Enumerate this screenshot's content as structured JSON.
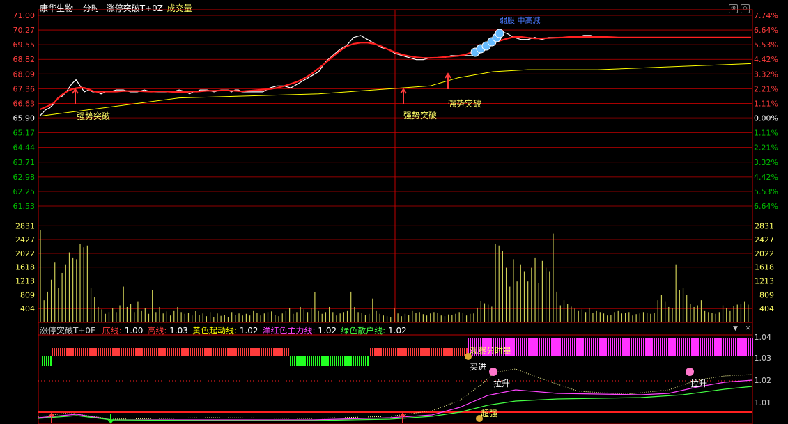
{
  "header": {
    "stock_name": "康华生物",
    "mode": "分时",
    "indicator": "涨停突破T+0Z",
    "volume_label": "成交量"
  },
  "price_axis": {
    "left": [
      "71.00",
      "70.27",
      "69.55",
      "68.82",
      "68.09",
      "67.36",
      "66.63",
      "65.90",
      "65.17",
      "64.44",
      "63.71",
      "62.98",
      "62.25",
      "61.53"
    ],
    "right": [
      "7.74%",
      "6.64%",
      "5.53%",
      "4.42%",
      "3.32%",
      "2.21%",
      "1.11%",
      "0.00%",
      "1.11%",
      "2.21%",
      "3.32%",
      "4.42%",
      "5.53%",
      "6.64%"
    ],
    "base_index": 7
  },
  "volume_axis": {
    "labels": [
      "2831",
      "2427",
      "2022",
      "1618",
      "1213",
      "809",
      "404"
    ]
  },
  "annotations": {
    "breakout1": "强势突破",
    "breakout2": "强势突破",
    "breakout3": "强势突破",
    "weak": "弱股 中高减"
  },
  "sub_panel": {
    "name": "涨停突破T+0F",
    "legend": [
      {
        "label": "底线:",
        "value": "1.00",
        "color": "#ff3c3c"
      },
      {
        "label": "高线:",
        "value": "1.03",
        "color": "#ff3c3c"
      },
      {
        "label": "黄色起动线:",
        "value": "1.02",
        "color": "#ffff00"
      },
      {
        "label": "洋红色主力线:",
        "value": "1.02",
        "color": "#ff44ff"
      },
      {
        "label": "绿色散户线:",
        "value": "1.02",
        "color": "#44ff44"
      }
    ],
    "right_axis": [
      "1.04",
      "1.03",
      "1.02",
      "1.01"
    ],
    "labels": {
      "observe": "观察分时量",
      "buy": "买进",
      "pull1": "拉升",
      "pull2": "拉升",
      "strong": "超强"
    }
  },
  "colors": {
    "grid": "#c00000",
    "up": "#ff3c3c",
    "down": "#00c000",
    "price_line": "#ffffff",
    "avg_line": "#ffff00",
    "trend_line": "#ff2020",
    "volume": "#cccc55",
    "text_label": "#ffff66"
  },
  "chart_data": [
    {
      "type": "line",
      "title": "",
      "series": [
        {
          "name": "",
          "x": [
            0,
            8,
            14,
            20,
            26,
            33,
            40,
            46,
            52,
            58,
            64,
            70,
            76,
            82,
            88,
            94,
            100,
            110,
            120,
            130,
            140,
            150,
            160,
            170,
            180,
            190,
            200,
            210,
            215,
            220,
            225,
            230,
            240,
            250,
            260,
            270,
            275,
            280,
            285,
            290,
            300,
            310,
            320,
            330,
            340,
            350,
            360,
            370,
            380,
            390,
            400,
            410,
            420,
            430,
            440,
            450,
            460,
            470,
            480,
            490,
            500,
            510,
            520,
            530,
            540,
            550,
            560,
            570,
            580,
            590,
            600,
            610,
            620,
            630,
            640,
            650,
            660,
            670,
            680,
            690,
            700,
            710,
            720,
            730,
            740,
            750,
            760,
            770,
            780,
            790,
            800,
            810,
            820,
            830,
            840,
            850,
            860,
            870,
            880,
            890,
            900,
            910,
            920,
            930,
            940,
            950,
            960,
            970,
            980,
            990,
            1000,
            1010,
            1020
          ],
          "values": [
            66.0,
            66.3,
            66.4,
            66.6,
            66.9,
            67.0,
            67.3,
            67.6,
            67.8,
            67.5,
            67.2,
            67.3,
            67.2,
            67.2,
            67.1,
            67.2,
            67.2,
            67.3,
            67.3,
            67.2,
            67.2,
            67.3,
            67.2,
            67.2,
            67.2,
            67.2,
            67.3,
            67.2,
            67.1,
            67.2,
            67.2,
            67.3,
            67.3,
            67.2,
            67.3,
            67.3,
            67.2,
            67.3,
            67.3,
            67.2,
            67.2,
            67.2,
            67.2,
            67.4,
            67.5,
            67.5,
            67.4,
            67.6,
            67.8,
            68.0,
            68.2,
            68.7,
            69.0,
            69.3,
            69.5,
            69.9,
            70.0,
            69.8,
            69.6,
            69.4,
            69.3,
            69.1,
            69.0,
            68.9,
            68.8,
            68.8,
            68.9,
            68.9,
            68.9,
            69.0,
            69.0,
            69.0,
            69.0,
            69.1,
            69.3,
            69.8,
            70.2,
            70.1,
            69.9,
            69.8,
            69.8,
            69.9,
            69.8,
            69.9,
            69.9,
            69.9,
            69.9,
            69.9,
            70.0,
            70.0,
            69.9,
            69.9,
            69.9,
            69.9,
            69.9,
            69.9,
            69.9,
            69.9,
            69.9,
            69.9,
            69.9,
            69.9,
            69.9,
            69.9,
            69.9,
            69.9,
            69.9,
            69.9,
            69.9,
            69.9,
            69.9,
            69.9,
            69.9
          ]
        },
        {
          "name": "",
          "x": [
            0,
            200,
            400,
            560,
            600,
            650,
            700,
            800,
            1020
          ],
          "values": [
            66.0,
            66.9,
            67.1,
            67.5,
            67.9,
            68.2,
            68.3,
            68.3,
            68.6
          ]
        }
      ],
      "ylim": [
        61.53,
        71.0
      ],
      "base_price": 65.9
    },
    {
      "type": "bar",
      "title": "",
      "ylabel": "",
      "ylim": [
        0,
        3000
      ],
      "values": [
        2700,
        650,
        900,
        1250,
        1750,
        1000,
        1450,
        1700,
        2050,
        1900,
        1850,
        2300,
        2200,
        2250,
        1000,
        750,
        450,
        380,
        250,
        300,
        420,
        300,
        500,
        1050,
        450,
        550,
        300,
        600,
        350,
        420,
        250,
        950,
        300,
        450,
        260,
        320,
        200,
        350,
        450,
        300,
        250,
        280,
        200,
        330,
        220,
        260,
        180,
        300,
        150,
        260,
        190,
        220,
        160,
        300,
        210,
        260,
        200,
        250,
        200,
        350,
        280,
        200,
        260,
        300,
        320,
        220,
        180,
        260,
        350,
        420,
        250,
        300,
        450,
        380,
        300,
        420,
        880,
        350,
        250,
        300,
        450,
        300,
        200,
        260,
        300,
        350,
        900,
        450,
        300,
        280,
        220,
        250,
        700,
        350,
        250,
        200,
        180,
        160,
        420,
        260,
        180,
        250,
        220,
        350,
        280,
        300,
        240,
        200,
        260,
        300,
        280,
        200,
        180,
        230,
        210,
        250,
        300,
        280,
        200,
        250,
        260,
        430,
        620,
        560,
        520,
        460,
        2300,
        2250,
        2100,
        1600,
        1050,
        1850,
        1200,
        1700,
        1500,
        1200,
        1600,
        1900,
        1150,
        1800,
        1600,
        1500,
        2600,
        900,
        500,
        650,
        550,
        460,
        400,
        350,
        380,
        300,
        420,
        280,
        350,
        300,
        260,
        200,
        220,
        300,
        350,
        260,
        280,
        300,
        200,
        240,
        260,
        300,
        280,
        250,
        280,
        650,
        800,
        600,
        450,
        420,
        1700,
        950,
        1000,
        800,
        550,
        450,
        500,
        650,
        350,
        300,
        280,
        250,
        300,
        500,
        420,
        350,
        480,
        520,
        550,
        600,
        520
      ]
    }
  ]
}
